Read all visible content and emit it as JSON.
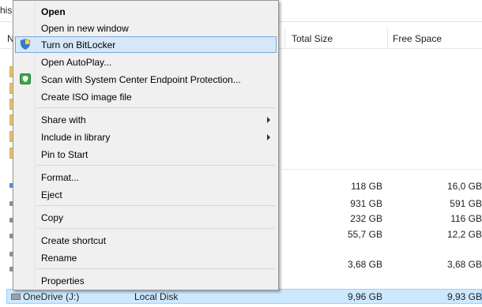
{
  "address": {
    "crumb": "his"
  },
  "columns": {
    "name": "N",
    "total_size": "Total Size",
    "free_space": "Free Space"
  },
  "drives": [
    {
      "total": "118 GB",
      "free": "16,0 GB"
    },
    {
      "total": "931 GB",
      "free": "591 GB"
    },
    {
      "total": "232 GB",
      "free": "116 GB"
    },
    {
      "total": "55,7 GB",
      "free": "12,2 GB"
    },
    {
      "total": "3,68 GB",
      "free": "3,68 GB"
    }
  ],
  "selected": {
    "name": "OneDrive (J:)",
    "type": "Local Disk",
    "total": "9,96 GB",
    "free": "9,93 GB"
  },
  "menu": {
    "open": "Open",
    "open_new_window": "Open in new window",
    "bitlocker": "Turn on BitLocker",
    "autoplay": "Open AutoPlay...",
    "scan": "Scan with System Center Endpoint Protection...",
    "iso": "Create ISO image file",
    "share_with": "Share with",
    "include_library": "Include in library",
    "pin_start": "Pin to Start",
    "format": "Format...",
    "eject": "Eject",
    "copy": "Copy",
    "create_shortcut": "Create shortcut",
    "rename": "Rename",
    "properties": "Properties"
  },
  "icons": {
    "bitlocker": "uac-shield-icon",
    "scan": "endpoint-protection-icon",
    "submenu": "chevron-right-icon"
  },
  "colors": {
    "hover_bg": "#d5e7f8",
    "hover_border": "#7aa7d9",
    "selected_bg": "#cce8ff"
  }
}
